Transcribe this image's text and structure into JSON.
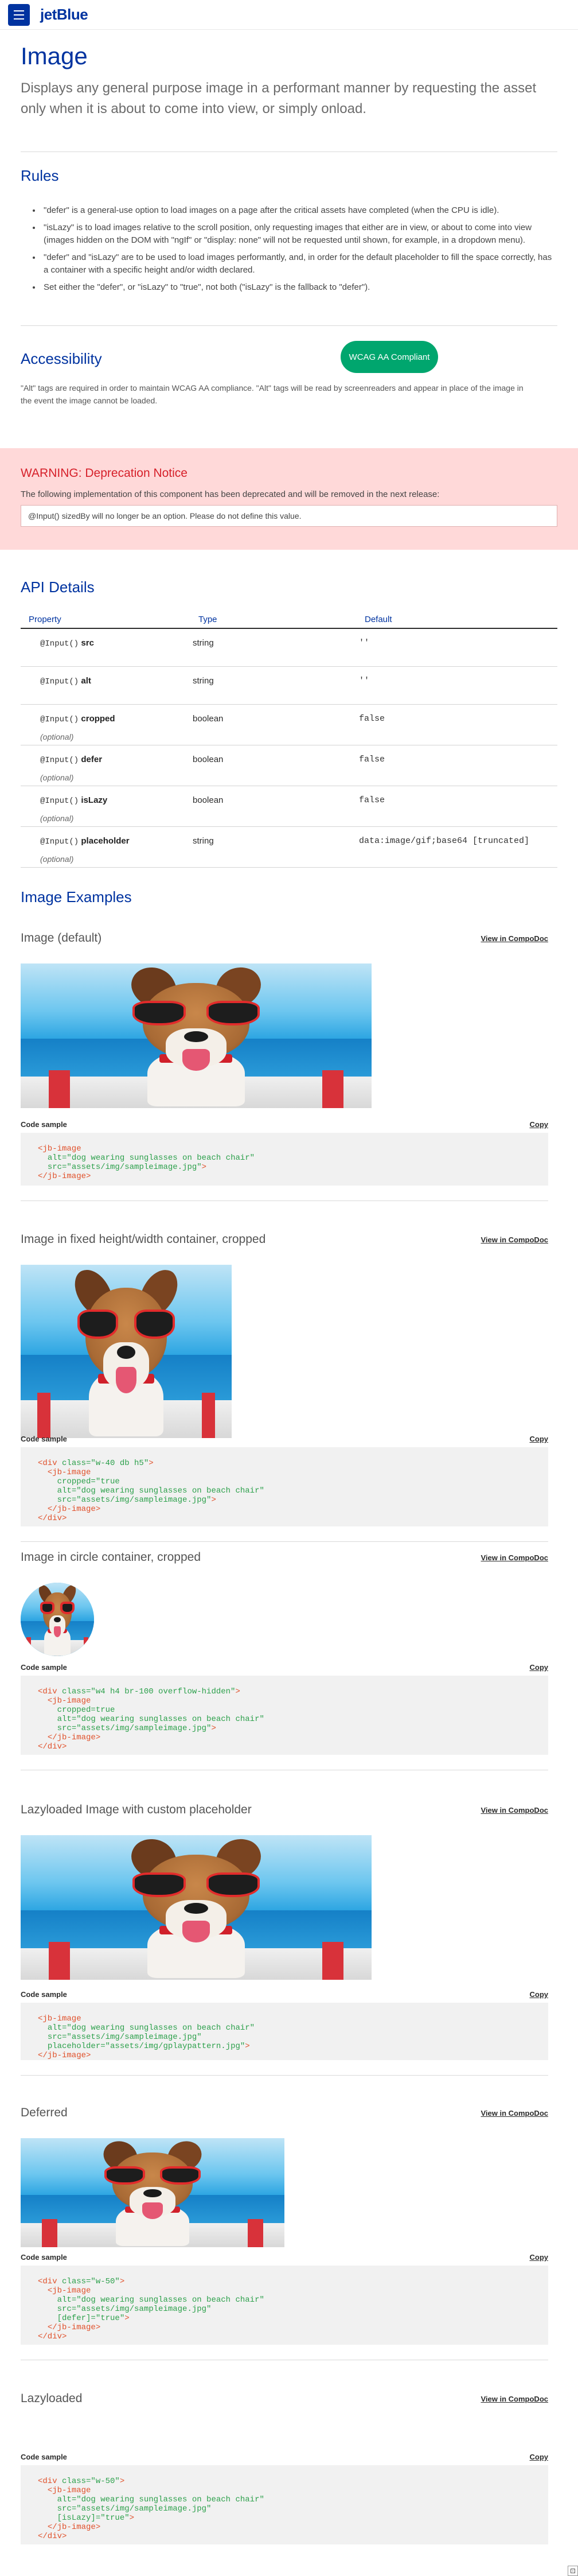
{
  "topbar": {
    "brand": "jetBlue"
  },
  "header": {
    "title": "Image",
    "lead": "Displays any general purpose image in a performant manner by requesting the asset only when it is about to come into view, or simply onload."
  },
  "rules": {
    "title": "Rules",
    "items": [
      "\"defer\" is a general-use option to load images on a page after the critical assets have completed (when the CPU is idle).",
      "\"isLazy\" is to load images relative to the scroll position, only requesting images that either are in view, or about to come into view (images hidden on the DOM with \"ngIf\" or \"display: none\" will not be requested until shown, for example, in a dropdown menu).",
      "\"defer\" and \"isLazy\" are to be used to load images performantly, and, in order for the default placeholder to fill the space correctly, has a container with a specific height and/or width declared.",
      "Set either the \"defer\", or \"isLazy\" to \"true\", not both (\"isLazy\" is the fallback to \"defer\")."
    ]
  },
  "accessibility": {
    "title": "Accessibility",
    "badge": "WCAG AA Compliant",
    "text": "\"Alt\" tags are required in order to maintain WCAG AA compliance. \"Alt\" tags will be read by screenreaders and appear in place of the image in the event the image cannot be loaded."
  },
  "warning": {
    "title": "WARNING: Deprecation Notice",
    "text": "The following implementation of this component has been deprecated and will be removed in the next release:",
    "box": "@Input() sizedBy will no longer be an option. Please do not define this value."
  },
  "api": {
    "title": "API Details",
    "headers": {
      "property": "Property",
      "type": "Type",
      "default": "Default"
    },
    "rows": [
      {
        "dec": "@Input()",
        "name": "src",
        "optional": "",
        "type": "string",
        "default": "''"
      },
      {
        "dec": "@Input()",
        "name": "alt",
        "optional": "",
        "type": "string",
        "default": "''"
      },
      {
        "dec": "@Input()",
        "name": "cropped",
        "optional": "(optional)",
        "type": "boolean",
        "default": "false"
      },
      {
        "dec": "@Input()",
        "name": "defer",
        "optional": "(optional)",
        "type": "boolean",
        "default": "false"
      },
      {
        "dec": "@Input()",
        "name": "isLazy",
        "optional": "(optional)",
        "type": "boolean",
        "default": "false"
      },
      {
        "dec": "@Input()",
        "name": "placeholder",
        "optional": "(optional)",
        "type": "string",
        "default": "data:image/gif;base64 [truncated]"
      }
    ]
  },
  "examples": {
    "title": "Image Examples",
    "link_label": "View in CompoDoc",
    "code_label": "Code sample",
    "copy_label": "Copy",
    "items": [
      {
        "name": "Image (default)",
        "code": "<jb-image\n  alt=\"dog wearing sunglasses on beach chair\"\n  src=\"assets/img/sampleimage.jpg\">\n</jb-image>"
      },
      {
        "name": "Image in fixed height/width container, cropped",
        "code": "<div class=\"w-40 db h5\">\n  <jb-image\n    cropped=\"true\n    alt=\"dog wearing sunglasses on beach chair\"\n    src=\"assets/img/sampleimage.jpg\">\n  </jb-image>\n</div>"
      },
      {
        "name": "Image in circle container, cropped",
        "code": "<div class=\"w4 h4 br-100 overflow-hidden\">\n  <jb-image\n    cropped=true\n    alt=\"dog wearing sunglasses on beach chair\"\n    src=\"assets/img/sampleimage.jpg\">\n  </jb-image>\n</div>"
      },
      {
        "name": "Lazyloaded Image with custom placeholder",
        "code": "<jb-image\n  alt=\"dog wearing sunglasses on beach chair\"\n  src=\"assets/img/sampleimage.jpg\"\n  placeholder=\"assets/img/gplaypattern.jpg\">\n</jb-image>"
      },
      {
        "name": "Deferred",
        "code": "<div class=\"w-50\">\n  <jb-image\n    alt=\"dog wearing sunglasses on beach chair\"\n    src=\"assets/img/sampleimage.jpg\"\n    [defer]=\"true\">\n  </jb-image>\n</div>"
      },
      {
        "name": "Lazyloaded",
        "code": "<div class=\"w-50\">\n  <jb-image\n    alt=\"dog wearing sunglasses on beach chair\"\n    src=\"assets/img/sampleimage.jpg\"\n    [isLazy]=\"true\">\n  </jb-image>\n</div>"
      }
    ]
  },
  "colors": {
    "brand": "#0033a0",
    "success": "#00a66e",
    "warning_bg": "#ffd9d9",
    "warning_text": "#d6202a"
  }
}
